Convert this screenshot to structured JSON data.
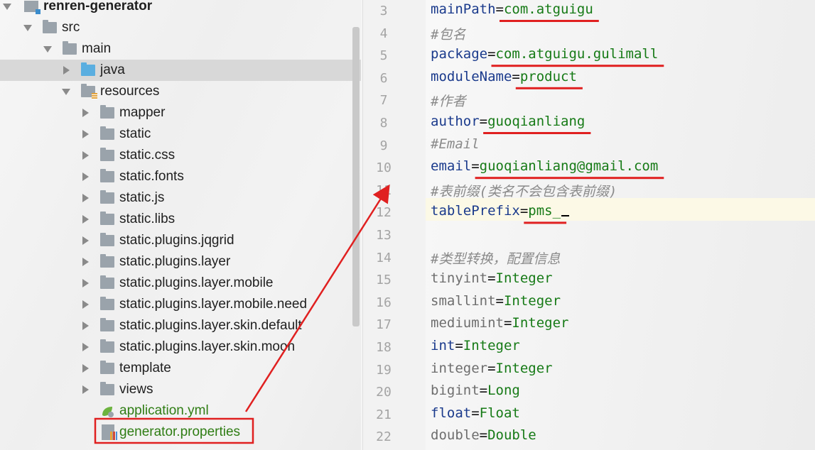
{
  "tree": {
    "items": [
      {
        "label": "renren-generator",
        "level": 0,
        "expanded": true,
        "icon": "module-icon"
      },
      {
        "label": "src",
        "level": 1,
        "expanded": true,
        "icon": "folder-icon"
      },
      {
        "label": "main",
        "level": 2,
        "expanded": true,
        "icon": "folder-icon"
      },
      {
        "label": "java",
        "level": 3,
        "expanded": false,
        "icon": "source-folder-icon",
        "selected": true
      },
      {
        "label": "resources",
        "level": 3,
        "expanded": true,
        "icon": "resources-folder-icon"
      },
      {
        "label": "mapper",
        "level": 4,
        "expanded": false,
        "icon": "folder-icon"
      },
      {
        "label": "static",
        "level": 4,
        "expanded": false,
        "icon": "folder-icon"
      },
      {
        "label": "static.css",
        "level": 4,
        "expanded": false,
        "icon": "folder-icon"
      },
      {
        "label": "static.fonts",
        "level": 4,
        "expanded": false,
        "icon": "folder-icon"
      },
      {
        "label": "static.js",
        "level": 4,
        "expanded": false,
        "icon": "folder-icon"
      },
      {
        "label": "static.libs",
        "level": 4,
        "expanded": false,
        "icon": "folder-icon"
      },
      {
        "label": "static.plugins.jqgrid",
        "level": 4,
        "expanded": false,
        "icon": "folder-icon"
      },
      {
        "label": "static.plugins.layer",
        "level": 4,
        "expanded": false,
        "icon": "folder-icon"
      },
      {
        "label": "static.plugins.layer.mobile",
        "level": 4,
        "expanded": false,
        "icon": "folder-icon"
      },
      {
        "label": "static.plugins.layer.mobile.need",
        "level": 4,
        "expanded": false,
        "icon": "folder-icon"
      },
      {
        "label": "static.plugins.layer.skin.default",
        "level": 4,
        "expanded": false,
        "icon": "folder-icon"
      },
      {
        "label": "static.plugins.layer.skin.moon",
        "level": 4,
        "expanded": false,
        "icon": "folder-icon"
      },
      {
        "label": "template",
        "level": 4,
        "expanded": false,
        "icon": "folder-icon"
      },
      {
        "label": "views",
        "level": 4,
        "expanded": false,
        "icon": "folder-icon"
      },
      {
        "label": "application.yml",
        "level": 4,
        "icon": "spring-yml-icon",
        "file": true
      },
      {
        "label": "generator.properties",
        "level": 4,
        "icon": "properties-file-icon",
        "file": true,
        "highlighted": true
      }
    ]
  },
  "editor": {
    "lines": [
      {
        "n": "3",
        "key": "mainPath",
        "value": "com.atguigu"
      },
      {
        "n": "4",
        "comment": "#包名"
      },
      {
        "n": "5",
        "key": "package",
        "value": "com.atguigu.gulimall"
      },
      {
        "n": "6",
        "key": "moduleName",
        "value": "product"
      },
      {
        "n": "7",
        "comment": "#作者"
      },
      {
        "n": "8",
        "key": "author",
        "value": "guoqianliang"
      },
      {
        "n": "9",
        "comment": "#Email"
      },
      {
        "n": "10",
        "key": "email",
        "value": "guoqianliang@gmail.com"
      },
      {
        "n": "11",
        "comment": "#表前缀(类名不会包含表前缀)"
      },
      {
        "n": "12",
        "key": "tablePrefix",
        "value": "pms_",
        "current": true
      },
      {
        "n": "13"
      },
      {
        "n": "14",
        "comment": "#类型转换，配置信息"
      },
      {
        "n": "15",
        "key": "tinyint",
        "value": "Integer",
        "dim": true
      },
      {
        "n": "16",
        "key": "smallint",
        "value": "Integer",
        "dim": true
      },
      {
        "n": "17",
        "key": "mediumint",
        "value": "Integer",
        "dim": true
      },
      {
        "n": "18",
        "key": "int",
        "value": "Integer"
      },
      {
        "n": "19",
        "key": "integer",
        "value": "Integer",
        "dim": true
      },
      {
        "n": "20",
        "key": "bigint",
        "value": "Long",
        "dim": true
      },
      {
        "n": "21",
        "key": "float",
        "value": "Float"
      },
      {
        "n": "22",
        "key": "double",
        "value": "Double",
        "dim": true
      }
    ]
  },
  "colors": {
    "annotation": "#e02020",
    "key": "#1a3a8c",
    "value": "#167a16",
    "comment": "#8a8a8a",
    "selection": "#d8d8d8",
    "current_line": "#fcf9e6"
  }
}
